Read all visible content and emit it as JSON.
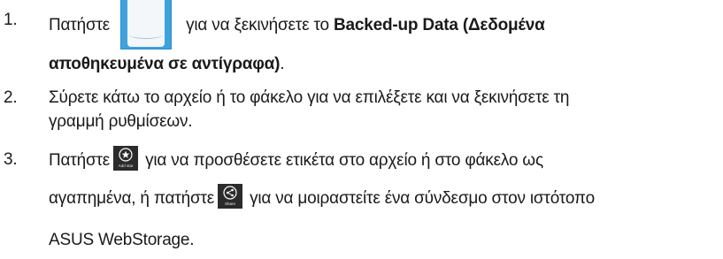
{
  "steps": [
    {
      "number": "1.",
      "before_icon": "Πατήστε",
      "icon": "backed-up-data-app-icon",
      "after_icon": "για να ξεκινήσετε το",
      "bold_line1": "Backed-up Data (Δεδομένα",
      "bold_line2": "αποθηκευμένα σε αντίγραφα)",
      "end": "."
    },
    {
      "number": "2.",
      "line1": "Σύρετε κάτω το αρχείο ή το φάκελο για να επιλέξετε και να ξεκινήσετε τη",
      "line2": "γραμμή ρυθμίσεων."
    },
    {
      "number": "3.",
      "before_icon1": "Πατήστε",
      "icon1": "add-star-icon",
      "icon1_label": "Add star",
      "after_icon1": "για να προσθέσετε ετικέτα στο αρχείο ή στο φάκελο ως",
      "before_icon2": "αγαπημένα, ή πατήστε",
      "icon2": "share-icon",
      "icon2_label": "Share",
      "after_icon2": "για να μοιραστείτε ένα σύνδεσμο στον ιστότοπο",
      "line3": "ASUS WebStorage."
    }
  ],
  "colors": {
    "tile_blue": "#3fa2dc",
    "charm_dark": "#2b2b2b",
    "text": "#1a1a1a"
  }
}
